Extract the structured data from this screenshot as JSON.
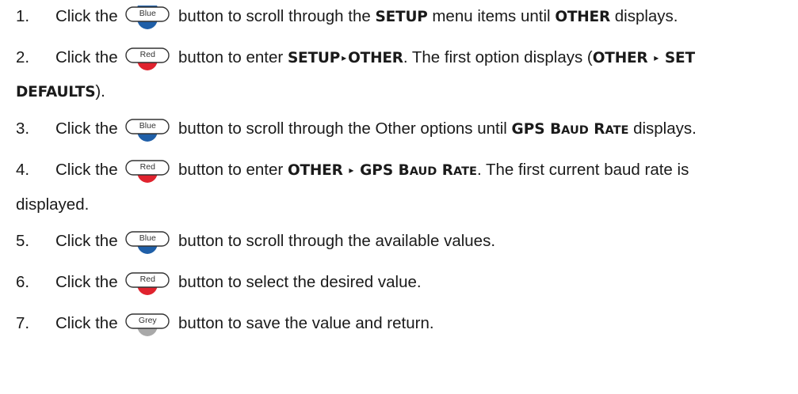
{
  "common": {
    "click_the": "Click the",
    "button_blue": "Blue",
    "button_red": "Red",
    "button_grey": "Grey",
    "arrow": "▸"
  },
  "colors": {
    "blue": "#1f5fa8",
    "red": "#e0232e",
    "grey": "#a9a9a9"
  },
  "steps": [
    {
      "num": "1.",
      "pre": "button to scroll through the",
      "k1": "SETUP",
      "mid": "menu items until",
      "k2": "OTHER",
      "post": "displays."
    },
    {
      "num": "2.",
      "pre": "button to enter",
      "k1": "SETUP",
      "k2": "OTHER",
      "mid": ". The first option displays (",
      "k3": "OTHER",
      "k4a": "SET",
      "k4b": "DEFAULTS",
      "post": ")."
    },
    {
      "num": "3.",
      "pre": "button to scroll through the Other options until",
      "post": "displays."
    },
    {
      "num": "4.",
      "pre": "button to enter",
      "k1": "OTHER",
      "mid": ". The first current baud rate is",
      "post": "displayed."
    },
    {
      "num": "5.",
      "pre": "button to scroll through the available values."
    },
    {
      "num": "6.",
      "pre": "button to select the desired value."
    },
    {
      "num": "7.",
      "pre": "button to save the value and return."
    }
  ],
  "gps": {
    "g": "GPS",
    "b": "B",
    "aud": "AUD",
    "r": "R",
    "ate": "ATE"
  }
}
